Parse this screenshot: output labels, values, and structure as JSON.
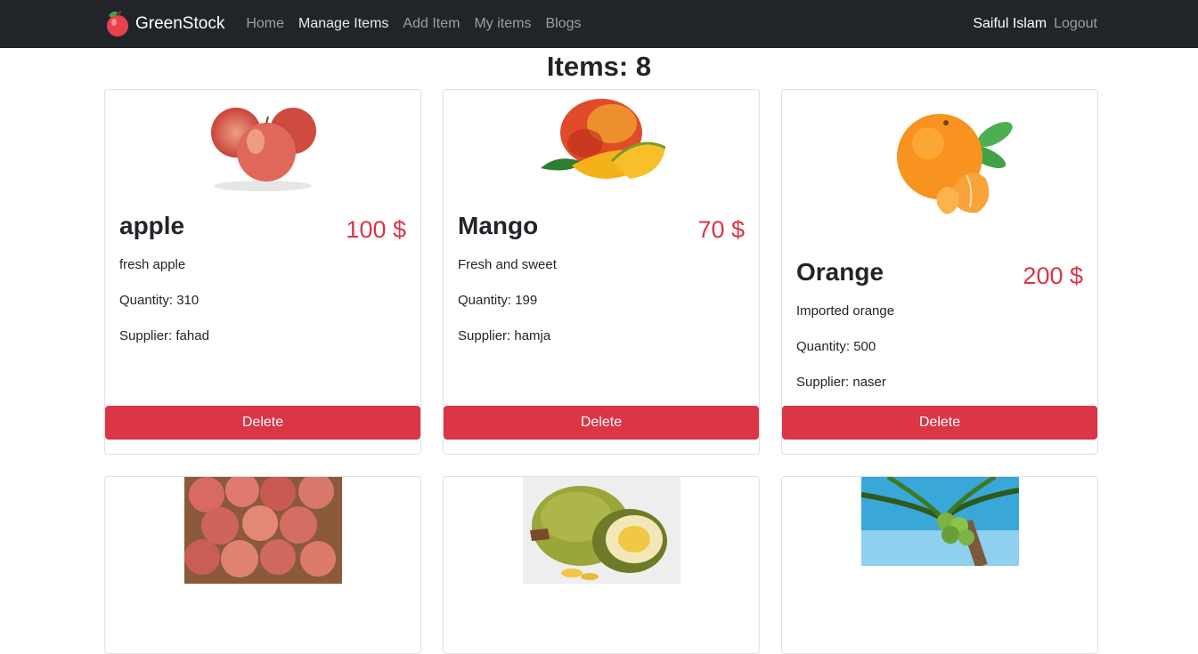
{
  "nav": {
    "brand": "GreenStock",
    "links": [
      "Home",
      "Manage Items",
      "Add Item",
      "My items",
      "Blogs"
    ],
    "active_index": 1,
    "user_name": "Saiful Islam",
    "logout": "Logout"
  },
  "page": {
    "title": "Items: 8"
  },
  "items": [
    {
      "name": "apple",
      "price": "100 $",
      "description": "fresh apple",
      "quantity": "Quantity: 310",
      "supplier": "Supplier: fahad",
      "delete_label": "Delete",
      "image": "apple-image"
    },
    {
      "name": "Mango",
      "price": "70 $",
      "description": "Fresh and sweet",
      "quantity": "Quantity: 199",
      "supplier": "Supplier: hamja",
      "delete_label": "Delete",
      "image": "mango-image"
    },
    {
      "name": "Orange",
      "price": "200 $",
      "description": "Imported orange",
      "quantity": "Quantity: 500",
      "supplier": "Supplier: naser",
      "delete_label": "Delete",
      "image": "orange-image"
    }
  ],
  "partial_items": [
    {
      "image": "lychee-image"
    },
    {
      "image": "jackfruit-image"
    },
    {
      "image": "coconut-image"
    }
  ],
  "colors": {
    "navbar": "#212529",
    "price": "#dc3545",
    "delete": "#dc3545"
  }
}
